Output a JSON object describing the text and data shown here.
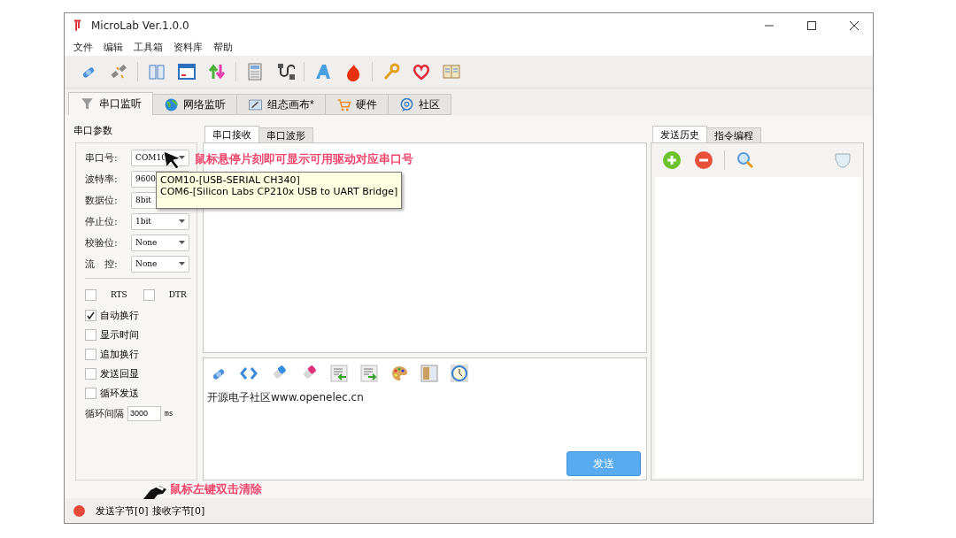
{
  "window": {
    "title": "MicroLab Ver.1.0.0"
  },
  "menu": [
    "文件",
    "编辑",
    "工具箱",
    "资料库",
    "帮助"
  ],
  "main_tabs": [
    {
      "label": "串口监听",
      "selected": true
    },
    {
      "label": "网络监听",
      "selected": false
    },
    {
      "label": "组态画布*",
      "selected": false
    },
    {
      "label": "硬件",
      "selected": false
    },
    {
      "label": "社区",
      "selected": false
    }
  ],
  "serial_params": {
    "title": "串口参数",
    "fields": [
      {
        "label": "串口号:",
        "value": "COM10"
      },
      {
        "label": "波特率:",
        "value": "9600"
      },
      {
        "label": "数据位:",
        "value": "8bit"
      },
      {
        "label": "停止位:",
        "value": "1bit"
      },
      {
        "label": "校验位:",
        "value": "None"
      },
      {
        "label": "流　控:",
        "value": "None"
      }
    ],
    "line_signals": [
      {
        "label": "RTS",
        "checked": false
      },
      {
        "label": "DTR",
        "checked": false
      }
    ],
    "options": [
      {
        "label": "自动换行",
        "checked": true
      },
      {
        "label": "显示时间",
        "checked": false
      },
      {
        "label": "追加换行",
        "checked": false
      },
      {
        "label": "发送回显",
        "checked": false
      },
      {
        "label": "循环发送",
        "checked": false
      }
    ],
    "interval": {
      "label": "循环间隔",
      "value": "3000",
      "unit": "ms"
    }
  },
  "receive_tabs": [
    {
      "label": "串口接收",
      "selected": true
    },
    {
      "label": "串口波形",
      "selected": false
    }
  ],
  "send": {
    "text": "开源电子社区www.openelec.cn",
    "button": "发送"
  },
  "history_tabs": [
    {
      "label": "发送历史",
      "selected": true
    },
    {
      "label": "指令编程",
      "selected": false
    }
  ],
  "status": {
    "items": [
      "发送字节[0]",
      "接收字节[0]"
    ]
  },
  "tooltip": {
    "lines": [
      "COM10-[USB-SERIAL CH340]",
      "COM6-[Silicon Labs CP210x USB to UART Bridge]"
    ]
  },
  "annotations": [
    {
      "kind": "hover",
      "text": "鼠标悬停片刻即可显示可用驱动对应串口号"
    },
    {
      "kind": "clear",
      "text": "鼠标左键双击清除"
    }
  ]
}
